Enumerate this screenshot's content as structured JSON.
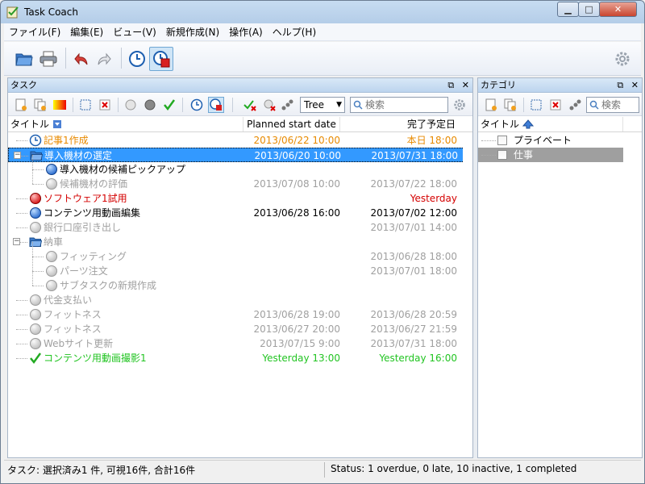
{
  "window": {
    "title": "Task Coach"
  },
  "menu": [
    "ファイル(F)",
    "編集(E)",
    "ビュー(V)",
    "新規作成(N)",
    "操作(A)",
    "ヘルプ(H)"
  ],
  "tasks_panel": {
    "title": "タスク",
    "tree_mode": "Tree",
    "search_placeholder": "検索",
    "columns": {
      "title": "タイトル",
      "start": "Planned start date",
      "due": "完了予定日"
    },
    "rows": [
      {
        "level": 0,
        "title": "記事1作成",
        "start": "2013/06/22 10:00",
        "due": "本日 18:00",
        "color": "#e88a00",
        "icon": "clock-icon"
      },
      {
        "level": 0,
        "title": "導入機材の選定",
        "start": "2013/06/20 10:00",
        "due": "2013/07/31 18:00",
        "color": "#ffffff",
        "icon": "folder-open-icon",
        "selected": true,
        "expanded": true
      },
      {
        "level": 1,
        "title": "導入機材の候補ピックアップ",
        "start": "",
        "due": "",
        "color": "#000000",
        "icon": "blue-ball-icon"
      },
      {
        "level": 1,
        "title": "候補機材の評価",
        "start": "2013/07/08 10:00",
        "due": "2013/07/22 18:00",
        "color": "#a0a0a0",
        "icon": "grey-ball-icon"
      },
      {
        "level": 0,
        "title": "ソフトウェア1試用",
        "start": "",
        "due": "Yesterday",
        "color": "#d40000",
        "icon": "red-ball-icon"
      },
      {
        "level": 0,
        "title": "コンテンツ用動画編集",
        "start": "2013/06/28 16:00",
        "due": "2013/07/02 12:00",
        "color": "#000000",
        "icon": "blue-ball-icon"
      },
      {
        "level": 0,
        "title": "銀行口座引き出し",
        "start": "",
        "due": "2013/07/01 14:00",
        "color": "#a0a0a0",
        "icon": "grey-ball-icon"
      },
      {
        "level": 0,
        "title": "納車",
        "start": "",
        "due": "",
        "color": "#a0a0a0",
        "icon": "folder-open-icon",
        "expanded": true
      },
      {
        "level": 1,
        "title": "フィッティング",
        "start": "",
        "due": "2013/06/28 18:00",
        "color": "#a0a0a0",
        "icon": "grey-ball-icon"
      },
      {
        "level": 1,
        "title": "パーツ注文",
        "start": "",
        "due": "2013/07/01 18:00",
        "color": "#a0a0a0",
        "icon": "grey-ball-icon"
      },
      {
        "level": 1,
        "title": "サブタスクの新規作成",
        "start": "",
        "due": "",
        "color": "#a0a0a0",
        "icon": "grey-ball-icon"
      },
      {
        "level": 0,
        "title": "代金支払い",
        "start": "",
        "due": "",
        "color": "#a0a0a0",
        "icon": "grey-ball-icon"
      },
      {
        "level": 0,
        "title": "フィットネス",
        "start": "2013/06/28 19:00",
        "due": "2013/06/28 20:59",
        "color": "#a0a0a0",
        "icon": "grey-ball-icon"
      },
      {
        "level": 0,
        "title": "フィットネス",
        "start": "2013/06/27 20:00",
        "due": "2013/06/27 21:59",
        "color": "#a0a0a0",
        "icon": "grey-ball-icon"
      },
      {
        "level": 0,
        "title": "Webサイト更新",
        "start": "2013/07/15 9:00",
        "due": "2013/07/31 18:00",
        "color": "#a0a0a0",
        "icon": "grey-ball-icon"
      },
      {
        "level": 0,
        "title": "コンテンツ用動画撮影1",
        "start": "Yesterday 13:00",
        "due": "Yesterday 16:00",
        "color": "#22c422",
        "icon": "checkmark-icon"
      }
    ]
  },
  "categories_panel": {
    "title": "カテゴリ",
    "search_placeholder": "検索",
    "column_title": "タイトル",
    "rows": [
      {
        "title": "プライベート",
        "selected": false
      },
      {
        "title": "仕事",
        "selected": true
      }
    ]
  },
  "status": {
    "left": "タスク: 選択済み1 件, 可視16件, 合計16件",
    "right": "Status: 1 overdue, 0 late, 10 inactive, 1 completed"
  },
  "colors": {
    "selection": "#3399ff",
    "panel_header": "#bcd4ee"
  }
}
